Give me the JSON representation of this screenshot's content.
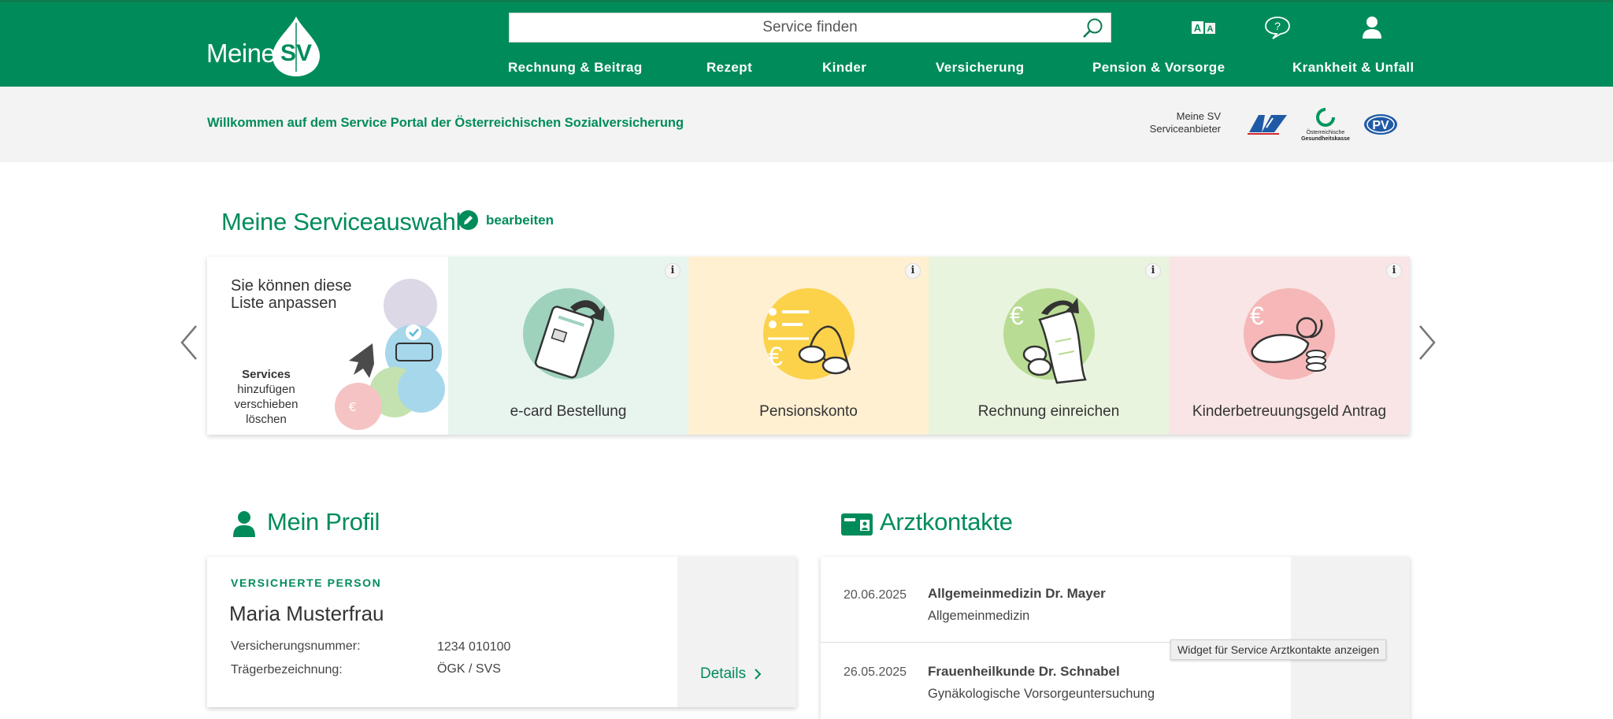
{
  "header": {
    "logo_text": "Meine",
    "logo_mark": "SV",
    "search": {
      "placeholder": "Service finden",
      "icon": "search-icon"
    },
    "icons": [
      "font-size-icon",
      "help-icon",
      "user-icon"
    ],
    "font_icon_letters": [
      "A",
      "A"
    ],
    "help_icon_glyph": "?",
    "nav": [
      "Rechnung & Beitrag",
      "Rezept",
      "Kinder",
      "Versicherung",
      "Pension & Vorsorge",
      "Krankheit & Unfall"
    ]
  },
  "subheader": {
    "welcome": "Willkommen auf dem Service Portal der Österreichischen Sozialversicherung",
    "provider_label_1": "Meine SV",
    "provider_label_2": "Serviceanbieter",
    "providers": {
      "oegk_line1": "Österreichische",
      "oegk_line2": "Gesundheitskasse",
      "pv": "PV"
    }
  },
  "services": {
    "title": "Meine Serviceauswahl",
    "edit_label": "bearbeiten",
    "intro": {
      "title": "Sie können diese Liste anpassen",
      "heading": "Services",
      "items": [
        "hinzufügen",
        "verschieben",
        "löschen"
      ]
    },
    "info_glyph": "i",
    "euro_glyph": "€",
    "tiles": [
      {
        "label": "e-card Bestellung",
        "bg": "#e8f5ef",
        "circle": "#9ed2bd"
      },
      {
        "label": "Pensionskonto",
        "bg": "#fff0d2",
        "circle": "#fbd24a"
      },
      {
        "label": "Rechnung einreichen",
        "bg": "#e9f4df",
        "circle": "#b9dc94"
      },
      {
        "label": "Kinderbetreuungsgeld Antrag",
        "bg": "#f9e5e5",
        "circle": "#f5b7b7"
      }
    ]
  },
  "profile": {
    "title": "Mein Profil",
    "label": "VERSICHERTE PERSON",
    "name": "Maria Musterfrau",
    "fields": [
      {
        "key": "Versicherungsnummer:",
        "value": "1234 010100"
      },
      {
        "key": "Trägerbezeichnung:",
        "value": "ÖGK / SVS"
      }
    ],
    "details_label": "Details"
  },
  "contacts": {
    "title": "Arztkontakte",
    "items": [
      {
        "date": "20.06.2025",
        "name": "Allgemeinmedizin Dr. Mayer",
        "type": "Allgemeinmedizin"
      },
      {
        "date": "26.05.2025",
        "name": "Frauenheilkunde Dr. Schnabel",
        "type": "Gynäkologische Vorsorgeuntersuchung"
      }
    ],
    "tooltip": "Widget für Service Arztkontakte anzeigen"
  },
  "colors": {
    "brand": "#008c5a",
    "subheader_bg": "#f2f3f2"
  }
}
